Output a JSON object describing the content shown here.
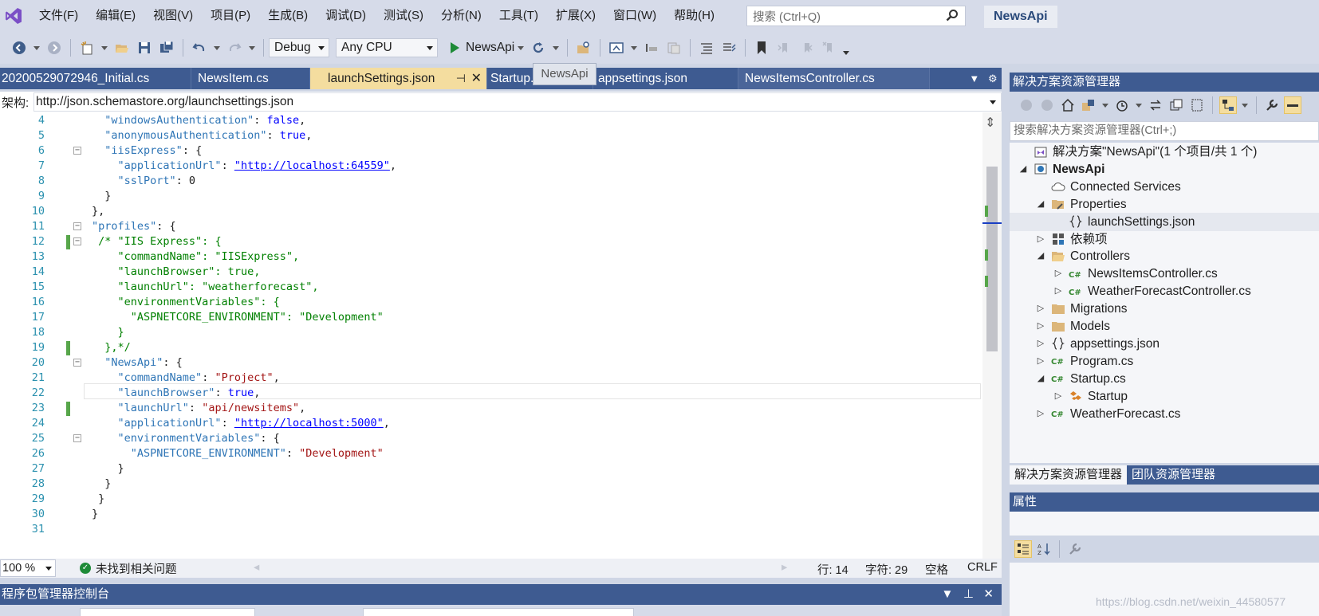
{
  "menu": {
    "items": [
      "文件(F)",
      "编辑(E)",
      "视图(V)",
      "项目(P)",
      "生成(B)",
      "调试(D)",
      "测试(S)",
      "分析(N)",
      "工具(T)",
      "扩展(X)",
      "窗口(W)",
      "帮助(H)"
    ],
    "search_placeholder": "搜索 (Ctrl+Q)",
    "project_title": "NewsApi"
  },
  "toolbar": {
    "config": "Debug",
    "platform": "Any CPU",
    "run_target": "NewsApi"
  },
  "tabs": [
    {
      "label": "20200529072946_Initial.cs",
      "active": false
    },
    {
      "label": "NewsItem.cs",
      "active": false
    },
    {
      "label": "launchSettings.json",
      "active": true
    },
    {
      "label": "Startup.cs",
      "active": false
    },
    {
      "label": "appsettings.json",
      "active": false
    },
    {
      "label": "NewsItemsController.cs",
      "active": false
    }
  ],
  "tab_tooltip": "NewsApi",
  "schema": {
    "label": "架构:",
    "url": "http://json.schemastore.org/launchsettings.json"
  },
  "code_lines": [
    {
      "n": "4",
      "fold": false,
      "change": false
    },
    {
      "n": "5",
      "fold": false,
      "change": false
    },
    {
      "n": "6",
      "fold": true,
      "change": false
    },
    {
      "n": "7",
      "fold": false,
      "change": false
    },
    {
      "n": "8",
      "fold": false,
      "change": false
    },
    {
      "n": "9",
      "fold": false,
      "change": false
    },
    {
      "n": "10",
      "fold": false,
      "change": false
    },
    {
      "n": "11",
      "fold": true,
      "change": false
    },
    {
      "n": "12",
      "fold": true,
      "change": true
    },
    {
      "n": "13",
      "fold": false,
      "change": false
    },
    {
      "n": "14",
      "fold": false,
      "change": false
    },
    {
      "n": "15",
      "fold": false,
      "change": false
    },
    {
      "n": "16",
      "fold": false,
      "change": false
    },
    {
      "n": "17",
      "fold": false,
      "change": false
    },
    {
      "n": "18",
      "fold": false,
      "change": false
    },
    {
      "n": "19",
      "fold": false,
      "change": true
    },
    {
      "n": "20",
      "fold": true,
      "change": false
    },
    {
      "n": "21",
      "fold": false,
      "change": false
    },
    {
      "n": "22",
      "fold": false,
      "change": false
    },
    {
      "n": "23",
      "fold": false,
      "change": true
    },
    {
      "n": "24",
      "fold": false,
      "change": false
    },
    {
      "n": "25",
      "fold": true,
      "change": false
    },
    {
      "n": "26",
      "fold": false,
      "change": false
    },
    {
      "n": "27",
      "fold": false,
      "change": false
    },
    {
      "n": "28",
      "fold": false,
      "change": false
    },
    {
      "n": "29",
      "fold": false,
      "change": false
    },
    {
      "n": "30",
      "fold": false,
      "change": false
    },
    {
      "n": "31",
      "fold": false,
      "change": false
    }
  ],
  "code": {
    "l4": {
      "indent": "  ",
      "key": "\"windowsAuthentication\"",
      "sep": ": ",
      "val": "false",
      "end": ","
    },
    "l5": {
      "indent": "  ",
      "key": "\"anonymousAuthentication\"",
      "sep": ": ",
      "val": "true",
      "end": ","
    },
    "l6": {
      "indent": "  ",
      "key": "\"iisExpress\"",
      "sep": ": {"
    },
    "l7": {
      "indent": "    ",
      "key": "\"applicationUrl\"",
      "sep": ": ",
      "url": "\"http://localhost:64559\"",
      "end": ","
    },
    "l8": {
      "indent": "    ",
      "key": "\"sslPort\"",
      "sep": ": 0"
    },
    "l9": {
      "indent": "  ",
      "text": "}"
    },
    "l10": {
      "indent": "",
      "text": "},"
    },
    "l11": {
      "indent": "",
      "key": "\"profiles\"",
      "sep": ": {"
    },
    "l12": {
      "indent": " ",
      "comment": "/* \"IIS Express\": {"
    },
    "l13": {
      "indent": "    ",
      "comment": "\"commandName\": \"IISExpress\","
    },
    "l14": {
      "indent": "    ",
      "comment": "\"launchBrowser\": true,"
    },
    "l15": {
      "indent": "    ",
      "comment": "\"launchUrl\": \"weatherforecast\","
    },
    "l16": {
      "indent": "    ",
      "comment": "\"environmentVariables\": {"
    },
    "l17": {
      "indent": "      ",
      "comment": "\"ASPNETCORE_ENVIRONMENT\": \"Development\""
    },
    "l18": {
      "indent": "    ",
      "comment": "}"
    },
    "l19": {
      "indent": "  ",
      "comment": "},*/"
    },
    "l20": {
      "indent": "  ",
      "key": "\"NewsApi\"",
      "sep": ": {"
    },
    "l21": {
      "indent": "    ",
      "key": "\"commandName\"",
      "sep": ": ",
      "str": "\"Project\"",
      "end": ","
    },
    "l22": {
      "indent": "    ",
      "key": "\"launchBrowser\"",
      "sep": ": ",
      "val": "true",
      "end": ","
    },
    "l23": {
      "indent": "    ",
      "key": "\"launchUrl\"",
      "sep": ": ",
      "str": "\"api/newsitems\"",
      "end": ","
    },
    "l24": {
      "indent": "    ",
      "key": "\"applicationUrl\"",
      "sep": ": ",
      "url": "\"http://localhost:5000\"",
      "end": ","
    },
    "l25": {
      "indent": "    ",
      "key": "\"environmentVariables\"",
      "sep": ": {"
    },
    "l26": {
      "indent": "      ",
      "key": "\"ASPNETCORE_ENVIRONMENT\"",
      "sep": ": ",
      "str": "\"Development\""
    },
    "l27": {
      "indent": "    ",
      "text": "}"
    },
    "l28": {
      "indent": "  ",
      "text": "}"
    },
    "l29": {
      "indent": "",
      "text": " }"
    },
    "l30": {
      "indent": "",
      "text": "}"
    },
    "l31": {
      "indent": "",
      "text": ""
    }
  },
  "status": {
    "zoom": "100 %",
    "issues": "未找到相关问题",
    "line": "行: 14",
    "char": "字符: 29",
    "space": "空格",
    "eol": "CRLF"
  },
  "package_manager": {
    "title": "程序包管理器控制台"
  },
  "solution_explorer": {
    "title": "解决方案资源管理器",
    "search_placeholder": "搜索解决方案资源管理器(Ctrl+;)",
    "tree": [
      {
        "label": "解决方案\"NewsApi\"(1 个项目/共 1 个)",
        "level": 0,
        "exp": "",
        "icon": "solution"
      },
      {
        "label": "NewsApi",
        "level": 0,
        "exp": "◢",
        "icon": "web",
        "bold": true
      },
      {
        "label": "Connected Services",
        "level": 1,
        "exp": "",
        "icon": "cloud"
      },
      {
        "label": "Properties",
        "level": 1,
        "exp": "◢",
        "icon": "props"
      },
      {
        "label": "launchSettings.json",
        "level": 2,
        "exp": "",
        "icon": "json",
        "selected": true
      },
      {
        "label": "依赖项",
        "level": 1,
        "exp": "▷",
        "icon": "deps"
      },
      {
        "label": "Controllers",
        "level": 1,
        "exp": "◢",
        "icon": "folder-open"
      },
      {
        "label": "NewsItemsController.cs",
        "level": 2,
        "exp": "▷",
        "icon": "cs"
      },
      {
        "label": "WeatherForecastController.cs",
        "level": 2,
        "exp": "▷",
        "icon": "cs"
      },
      {
        "label": "Migrations",
        "level": 1,
        "exp": "▷",
        "icon": "folder"
      },
      {
        "label": "Models",
        "level": 1,
        "exp": "▷",
        "icon": "folder"
      },
      {
        "label": "appsettings.json",
        "level": 1,
        "exp": "▷",
        "icon": "json"
      },
      {
        "label": "Program.cs",
        "level": 1,
        "exp": "▷",
        "icon": "cs"
      },
      {
        "label": "Startup.cs",
        "level": 1,
        "exp": "◢",
        "icon": "cs"
      },
      {
        "label": "Startup",
        "level": 2,
        "exp": "▷",
        "icon": "class"
      },
      {
        "label": "WeatherForecast.cs",
        "level": 1,
        "exp": "▷",
        "icon": "cs"
      }
    ],
    "tabs": [
      "解决方案资源管理器",
      "团队资源管理器"
    ]
  },
  "properties": {
    "title": "属性"
  },
  "watermark": "https://blog.csdn.net/weixin_44580577"
}
